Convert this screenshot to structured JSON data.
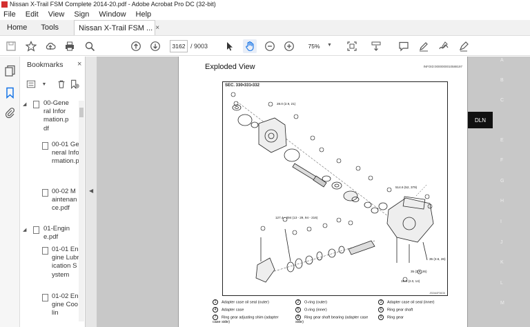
{
  "window": {
    "title": "Nissan X-Trail FSM Complete 2014-20.pdf - Adobe Acrobat Pro DC (32-bit)"
  },
  "menu": [
    "File",
    "Edit",
    "View",
    "Sign",
    "Window",
    "Help"
  ],
  "tabs": {
    "home": "Home",
    "tools": "Tools",
    "document": "Nissan X-Trail FSM ...",
    "close": "×"
  },
  "toolbar": {
    "page_current": "3162",
    "page_total": "/ 9003",
    "zoom": "75%"
  },
  "bookmarks": {
    "title": "Bookmarks",
    "close": "×",
    "items": [
      {
        "label": "00-General Information.pdf",
        "level": 0,
        "expanded": true
      },
      {
        "label": "00-01 General Information.p",
        "level": 1
      },
      {
        "label": "00-02 Maintenance.pdf",
        "level": 1
      },
      {
        "label": "01-Engine.pdf",
        "level": 0,
        "expanded": true
      },
      {
        "label": "01-01 Engine Lubrication System",
        "level": 1
      },
      {
        "label": "01-02 Engine Coolin",
        "level": 1
      }
    ]
  },
  "page": {
    "title": "Exploded View",
    "doc_id": "INFOID:0000000010588197",
    "section": "SEC. 330•331•332",
    "figure_code": "JSDIA0F36G6",
    "torques": {
      "t1": "28.0 (2.9, 21)",
      "t2": "514.6 (52, 379)",
      "t3": "127.4 - 294 (13 - 29, 94 - 216)",
      "t4": "35 (3.6, 26)",
      "t5": "35 (3.6, 26)",
      "t6": "19.6 (2.0, 14)"
    },
    "legend": [
      {
        "n": "1",
        "label": "Adapter case oil seal (outer)"
      },
      {
        "n": "2",
        "label": "O-ring (outer)"
      },
      {
        "n": "3",
        "label": "Adapter case oil seal (inner)"
      },
      {
        "n": "4",
        "label": "Adapter case"
      },
      {
        "n": "5",
        "label": "O-ring (inner)"
      },
      {
        "n": "6",
        "label": "Ring gear shaft"
      },
      {
        "n": "7",
        "label": "Ring gear adjusting shim (adapter case side)"
      },
      {
        "n": "8",
        "label": "Ring gear shaft bearing (adapter case side)"
      },
      {
        "n": "9",
        "label": "Ring gear"
      }
    ]
  },
  "ruler": {
    "letters": [
      "A",
      "B",
      "C",
      "E",
      "F",
      "G",
      "H",
      "I",
      "J",
      "K",
      "L",
      "M"
    ],
    "active": "DLN"
  }
}
